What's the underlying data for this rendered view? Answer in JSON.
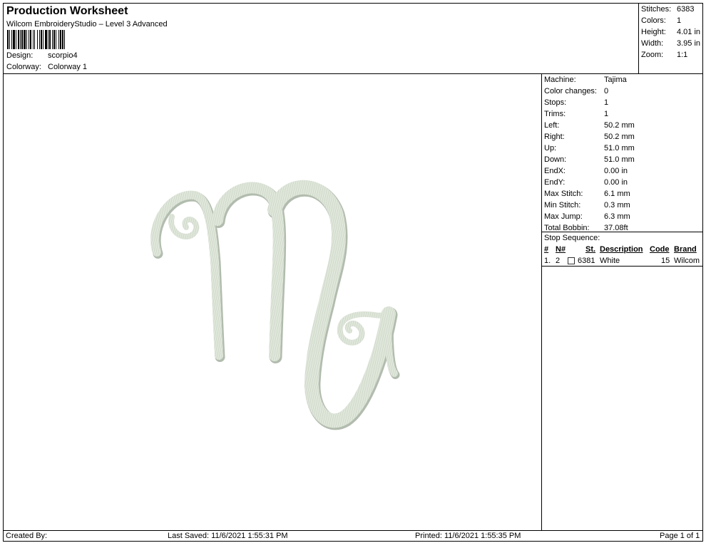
{
  "header": {
    "title": "Production Worksheet",
    "subtitle": "Wilcom EmbroideryStudio – Level 3 Advanced",
    "barcode_icon": "barcode-icon",
    "design_label": "Design:",
    "design_value": "scorpio4",
    "colorway_label": "Colorway:",
    "colorway_value": "Colorway 1"
  },
  "summary": {
    "stitches_label": "Stitches:",
    "stitches_value": "6383",
    "colors_label": "Colors:",
    "colors_value": "1",
    "height_label": "Height:",
    "height_value": "4.01 in",
    "width_label": "Width:",
    "width_value": "3.95 in",
    "zoom_label": "Zoom:",
    "zoom_value": "1:1"
  },
  "design": {
    "thread_color": "#dfe6da",
    "shadow_color": "#aab5a6",
    "icon": "scorpio-symbol-icon"
  },
  "info": {
    "machine_label": "Machine:",
    "machine_value": "Tajima",
    "color_changes_label": "Color changes:",
    "color_changes_value": "0",
    "stops_label": "Stops:",
    "stops_value": "1",
    "trims_label": "Trims:",
    "trims_value": "1",
    "left_label": "Left:",
    "left_value": "50.2 mm",
    "right_label": "Right:",
    "right_value": "50.2 mm",
    "up_label": "Up:",
    "up_value": "51.0 mm",
    "down_label": "Down:",
    "down_value": "51.0 mm",
    "endx_label": "EndX:",
    "endx_value": "0.00 in",
    "endy_label": "EndY:",
    "endy_value": "0.00 in",
    "max_stitch_label": "Max Stitch:",
    "max_stitch_value": "6.1 mm",
    "min_stitch_label": "Min Stitch:",
    "min_stitch_value": "0.3 mm",
    "max_jump_label": "Max Jump:",
    "max_jump_value": "6.3 mm",
    "total_bobbin_label": "Total Bobbin:",
    "total_bobbin_value": "37.08ft"
  },
  "stop_sequence": {
    "title": "Stop Sequence:",
    "columns": [
      "#",
      "N#",
      "St.",
      "Description",
      "Code",
      "Brand"
    ],
    "rows": [
      {
        "num": "1.",
        "n": "2",
        "st": "6381",
        "description": "White",
        "code": "15",
        "brand": "Wilcom",
        "swatch": "#ffffff"
      }
    ]
  },
  "footer": {
    "created_by": "Created By:",
    "last_saved": "Last Saved: 11/6/2021 1:55:31 PM",
    "printed": "Printed: 11/6/2021 1:55:35 PM",
    "page": "Page 1 of 1"
  }
}
